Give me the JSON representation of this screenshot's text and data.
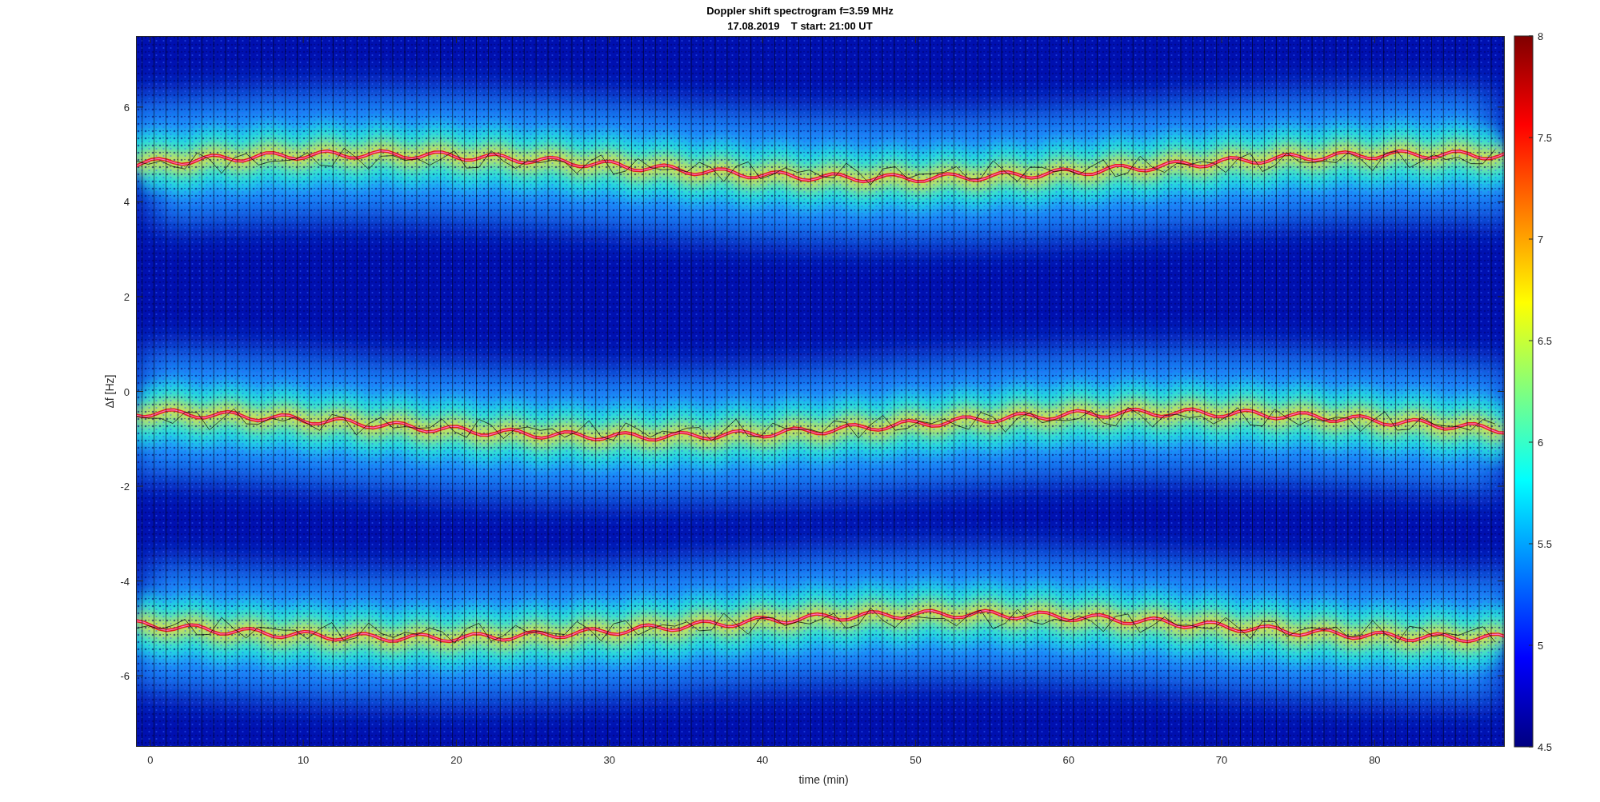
{
  "figure": {
    "title": "Doppler shift spectrogram f=3.59 MHz",
    "subtitle_parts": [
      "17.08.2019",
      "T start: 21:00 UT"
    ],
    "xlabel": "time (min)",
    "ylabel": "Δf [Hz]",
    "xticks": [
      "0",
      "10",
      "20",
      "30",
      "40",
      "50",
      "60",
      "70",
      "80"
    ],
    "yticks": [
      "6",
      "4",
      "2",
      "0",
      "-2",
      "-4",
      "-6"
    ],
    "colorbar": {
      "ticks": [
        "8",
        "7.5",
        "7",
        "6.5",
        "6",
        "5.5",
        "5",
        "4.5"
      ]
    }
  }
}
